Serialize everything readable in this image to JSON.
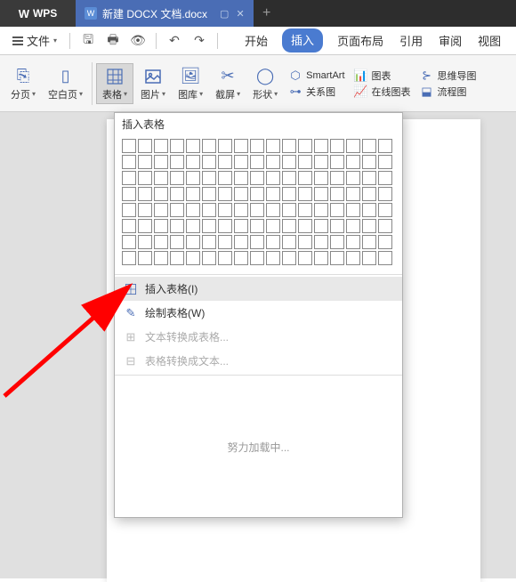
{
  "titlebar": {
    "logo": "WPS",
    "doc_name": "新建 DOCX 文档.docx",
    "doc_badge": "W"
  },
  "menubar": {
    "file_label": "文件",
    "tabs": [
      "开始",
      "插入",
      "页面布局",
      "引用",
      "审阅",
      "视图"
    ],
    "active_tab": "插入"
  },
  "ribbon": {
    "paging": "分页",
    "blank_page": "空白页",
    "table": "表格",
    "picture": "图片",
    "gallery": "图库",
    "screenshot": "截屏",
    "shapes": "形状",
    "smartart": "SmartArt",
    "relation": "关系图",
    "chart": "图表",
    "online_chart": "在线图表",
    "mindmap": "思维导图",
    "flowchart": "流程图"
  },
  "table_dropdown": {
    "header": "插入表格",
    "insert_table": "插入表格(I)",
    "draw_table": "绘制表格(W)",
    "text_to_table": "文本转换成表格...",
    "table_to_text": "表格转换成文本...",
    "loading": "努力加载中...",
    "grid_rows": 8,
    "grid_cols": 17
  }
}
